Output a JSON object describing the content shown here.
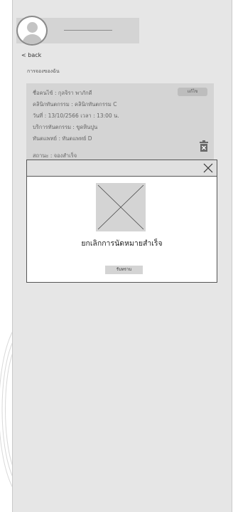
{
  "header": {
    "back_label": "< back"
  },
  "page": {
    "heading": "การจองของฉัน"
  },
  "booking": {
    "edit_label": "แก้ไข",
    "name": "ชื่อคนไข้ :  กุลจิรา  พาภักดี",
    "clinic": "คลินิกทันตกรรม :  คลินิกทันตกรรม C",
    "datetime": "วันที่ : 13/10/2566    เวลา : 13:00 น.",
    "service": "บริการทันตกรรม : ขูดหินปูน",
    "dentist": "ทันตแพทย์ :  ทันตแพทย์ D",
    "status": "สถานะ :  จองสำเร็จ"
  },
  "modal": {
    "message": "ยกเลิกการนัดหมายสำเร็จ",
    "ack_label": "รับทราบ"
  }
}
